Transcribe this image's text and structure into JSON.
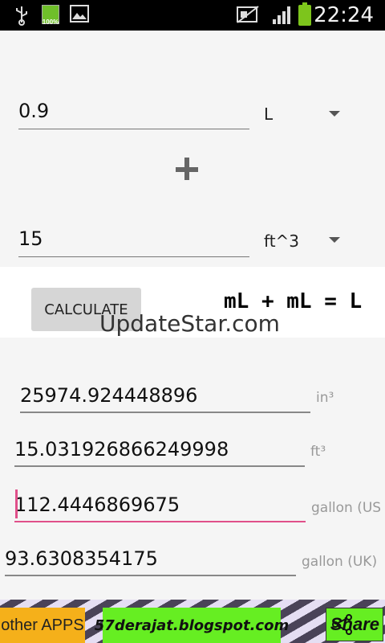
{
  "statusbar": {
    "time": "22:24",
    "battery_small_label": "100%",
    "icons": [
      "usb-icon",
      "battery-icon",
      "image-icon",
      "mute-icon",
      "signal-icon",
      "battery-charging-icon"
    ]
  },
  "input1": {
    "value": "0.9",
    "unit": "L"
  },
  "operator": "+",
  "input2": {
    "value": "15",
    "unit": "ft^3"
  },
  "calculate": {
    "label": "CALCULATE",
    "formula": "mL + mL = L"
  },
  "watermark": "UpdateStar.com",
  "results": [
    {
      "value": "25974.924448896",
      "unit": "in³"
    },
    {
      "value": "15.031926866249998",
      "unit": "ft³"
    },
    {
      "value": "112.4446869675",
      "unit": "gallon (US"
    },
    {
      "value": "93.6308354175",
      "unit": "gallon (UK)"
    }
  ],
  "bottom": {
    "other_apps": "other APPS",
    "blog": "57derajat.blogspot.com",
    "share": "Share"
  },
  "colors": {
    "accent": "#e0508a",
    "ad_green": "#66ee22",
    "ad_orange": "#f5b01a"
  }
}
